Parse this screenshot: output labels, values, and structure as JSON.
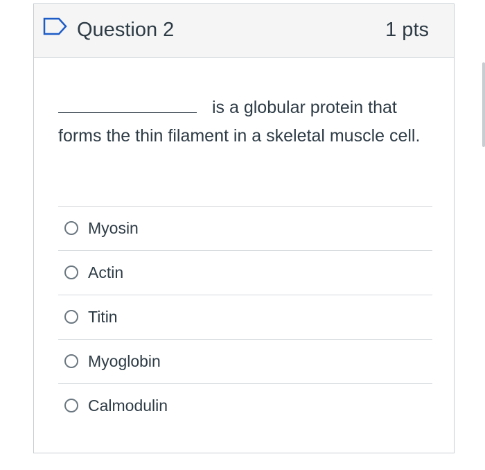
{
  "question": {
    "title": "Question 2",
    "points": "1 pts",
    "flag_icon": "flag-outline-icon",
    "text": "is a globular protein that forms the thin filament in a skeletal muscle cell."
  },
  "answers": [
    {
      "label": "Myosin",
      "selected": false
    },
    {
      "label": "Actin",
      "selected": false
    },
    {
      "label": "Titin",
      "selected": false
    },
    {
      "label": "Myoglobin",
      "selected": false
    },
    {
      "label": "Calmodulin",
      "selected": false
    }
  ],
  "colors": {
    "text": "#2d3b45",
    "header_bg": "#f5f5f5",
    "border": "#c7cdd1",
    "flag": "#1d5cc7"
  }
}
